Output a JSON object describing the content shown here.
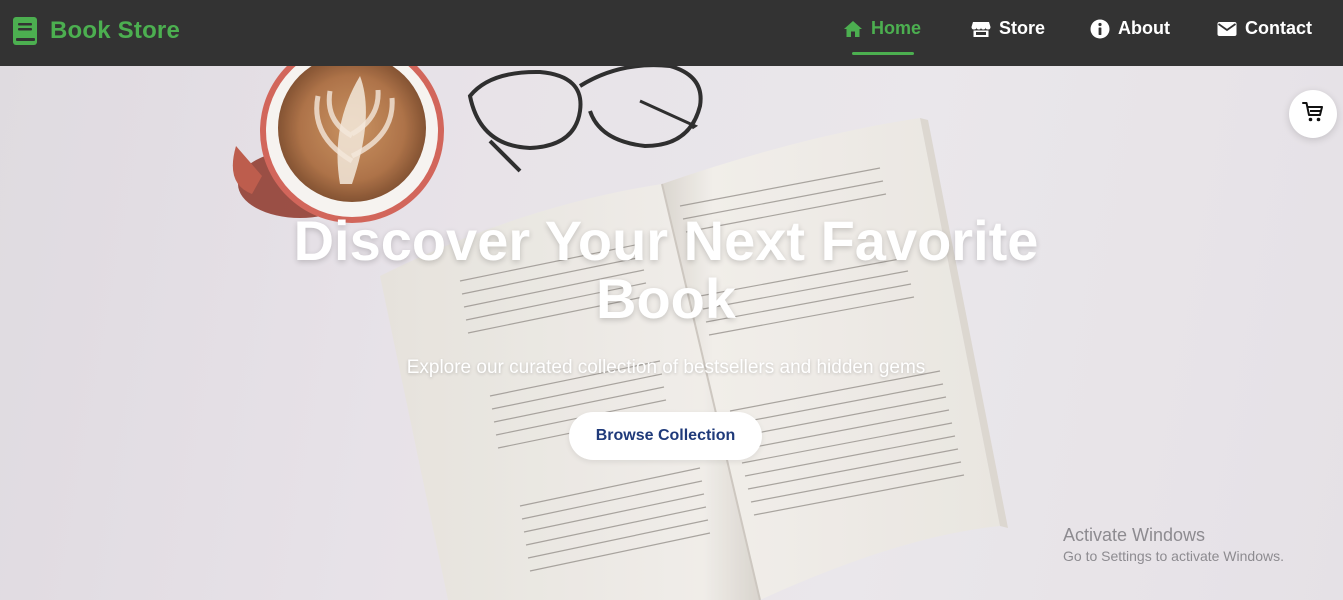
{
  "navbar": {
    "brand": {
      "label": "Book Store",
      "icon": "book-icon"
    },
    "links": [
      {
        "label": "Home",
        "icon": "home-icon",
        "active": true
      },
      {
        "label": "Store",
        "icon": "store-icon",
        "active": false
      },
      {
        "label": "About",
        "icon": "info-icon",
        "active": false
      },
      {
        "label": "Contact",
        "icon": "envelope-icon",
        "active": false
      }
    ]
  },
  "hero": {
    "title": "Discover Your Next Favorite Book",
    "subtitle": "Explore our curated collection of bestsellers and hidden gems",
    "cta_label": "Browse Collection",
    "cart_icon": "cart-icon"
  },
  "watermark": {
    "title": "Activate Windows",
    "subtitle": "Go to Settings to activate Windows."
  },
  "colors": {
    "navbar_bg": "#333333",
    "accent": "#4caf50",
    "cta_text": "#1f3a7a",
    "hero_text": "#ffffff"
  }
}
